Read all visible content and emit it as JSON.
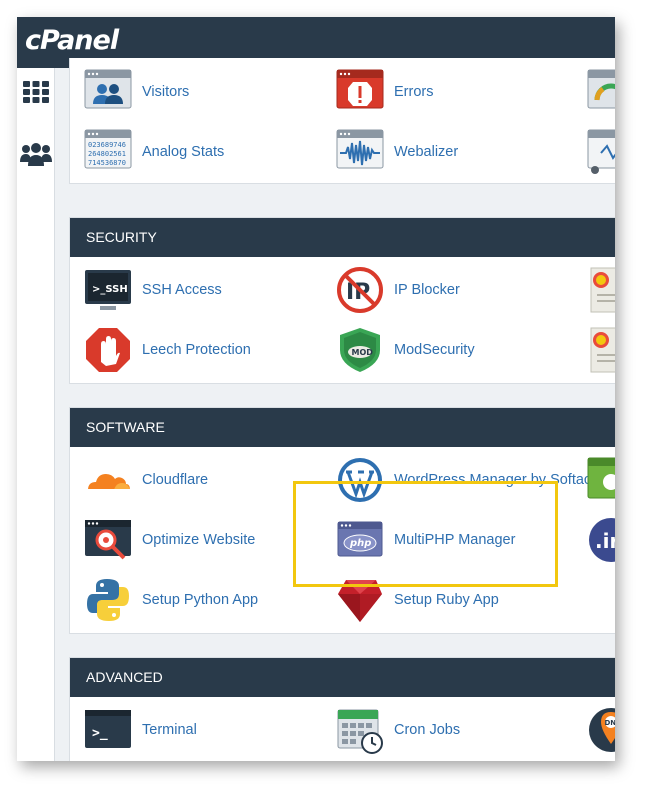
{
  "brand": {
    "logo_text": "cPanel",
    "header_color": "#293a4a",
    "link_color": "#2e6fb0",
    "highlight_color": "#f2c70f"
  },
  "sidebar": {
    "items": [
      {
        "icon": "grid-icon"
      },
      {
        "icon": "users-icon"
      }
    ]
  },
  "metrics": {
    "items": [
      {
        "label": "Visitors",
        "icon": "visitors-icon"
      },
      {
        "label": "Errors",
        "icon": "errors-icon"
      },
      {
        "label": "Analog Stats",
        "icon": "analog-stats-icon"
      },
      {
        "label": "Webalizer",
        "icon": "webalizer-icon"
      }
    ]
  },
  "security": {
    "title": "SECURITY",
    "items": [
      {
        "label": "SSH Access",
        "icon": "ssh-icon"
      },
      {
        "label": "IP Blocker",
        "icon": "ip-blocker-icon"
      },
      {
        "label": "Leech Protection",
        "icon": "leech-protection-icon"
      },
      {
        "label": "ModSecurity",
        "icon": "modsecurity-icon"
      }
    ]
  },
  "software": {
    "title": "SOFTWARE",
    "items": [
      {
        "label": "Cloudflare",
        "icon": "cloudflare-icon"
      },
      {
        "label": "WordPress Manager by Softaculous",
        "icon": "wordpress-icon"
      },
      {
        "label": "Optimize Website",
        "icon": "optimize-icon"
      },
      {
        "label": "MultiPHP Manager",
        "icon": "php-icon"
      },
      {
        "label": "Setup Python App",
        "icon": "python-icon"
      },
      {
        "label": "Setup Ruby App",
        "icon": "ruby-icon"
      }
    ]
  },
  "advanced": {
    "title": "ADVANCED",
    "items": [
      {
        "label": "Terminal",
        "icon": "terminal-icon"
      },
      {
        "label": "Cron Jobs",
        "icon": "cron-jobs-icon"
      }
    ]
  },
  "icon_text": {
    "analog_1": "023689746",
    "analog_2": "264802561",
    "analog_3": "714536870",
    "ssh": ">_SSH",
    "ip": "IP",
    "mod": "MOD",
    "php": "php",
    "ir": ".ir",
    "dn": "DN",
    "terminal": ">_"
  }
}
